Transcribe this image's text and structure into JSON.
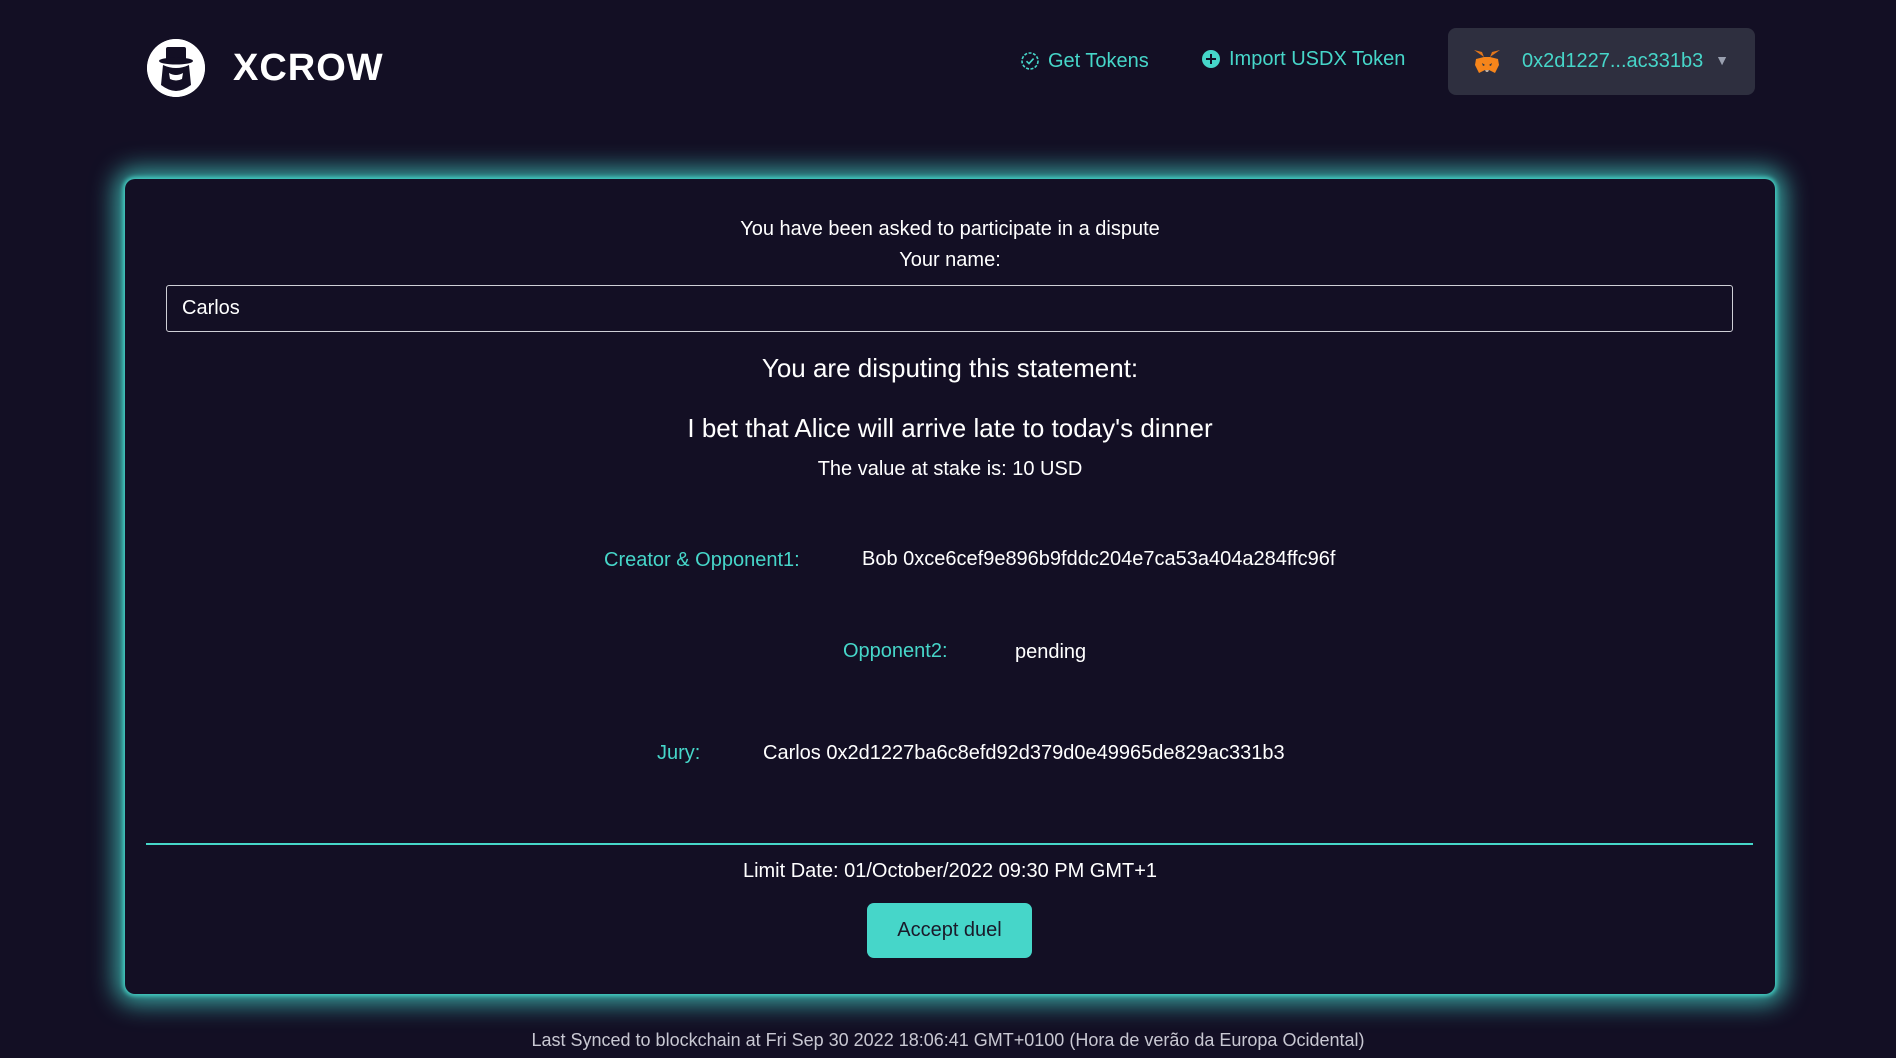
{
  "header": {
    "logo_text": "XCROW",
    "get_tokens_label": "Get Tokens",
    "import_token_label": "Import USDX Token",
    "wallet_address": "0x2d1227...ac331b3",
    "wallet_caret": "▼"
  },
  "card": {
    "invite_text": "You have been asked to participate in a dispute",
    "your_name_label": "Your name:",
    "name_value": "Carlos",
    "disputing_heading": "You are disputing this statement:",
    "statement": "I bet that Alice will arrive late to today's dinner",
    "stake_text": "The value at stake is: 10 USD",
    "creator_label": "Creator & Opponent1:",
    "creator_value": "Bob 0xce6cef9e896b9fddc204e7ca53a404a284ffc96f",
    "opponent2_label": "Opponent2:",
    "opponent2_value": "pending",
    "jury_label": "Jury:",
    "jury_value": "Carlos 0x2d1227ba6c8efd92d379d0e49965de829ac331b3",
    "limit_date": "Limit Date: 01/October/2022 09:30 PM GMT+1",
    "accept_button": "Accept duel"
  },
  "footer": {
    "sync_text": "Last Synced to blockchain at Fri Sep 30 2022 18:06:41 GMT+0100 (Hora de verão da Europa Ocidental)"
  },
  "colors": {
    "background": "#130f24",
    "accent": "#46d6c9",
    "wallet_bg": "#2e2f3f"
  },
  "icons": {
    "logo": "spy-hat-icon",
    "get_tokens": "check-circle-icon",
    "import_token": "plus-circle-icon",
    "wallet": "metamask-fox-icon"
  }
}
